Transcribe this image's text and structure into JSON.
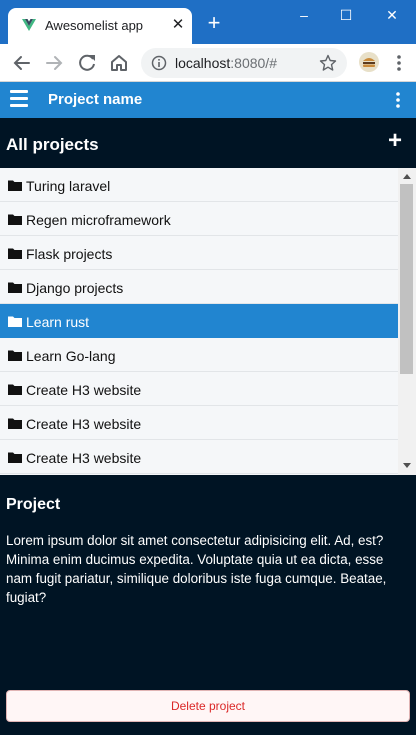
{
  "browser": {
    "tab_title": "Awesomelist app",
    "tab_close": "✕",
    "new_tab": "+",
    "url_host": "localhost",
    "url_rest": ":8080/#",
    "window_controls": [
      "–",
      "☐",
      "✕"
    ],
    "theme_color": "#1f6fc5"
  },
  "appbar": {
    "title": "Project name",
    "color": "#2185d0"
  },
  "projects": {
    "title": "All projects",
    "add_label": "+",
    "items": [
      {
        "label": "Turing laravel",
        "active": false
      },
      {
        "label": "Regen microframework",
        "active": false
      },
      {
        "label": "Flask projects",
        "active": false
      },
      {
        "label": "Django projects",
        "active": false
      },
      {
        "label": "Learn rust",
        "active": true
      },
      {
        "label": "Learn Go-lang",
        "active": false
      },
      {
        "label": "Create H3 website",
        "active": false
      },
      {
        "label": "Create H3 website",
        "active": false
      },
      {
        "label": "Create H3 website",
        "active": false
      }
    ]
  },
  "detail": {
    "title": "Project",
    "body": "Lorem ipsum dolor sit amet consectetur adipisicing elit. Ad, est? Minima enim ducimus expedita. Voluptate quia ut ea dicta, esse nam fugit pariatur, similique doloribus iste fuga cumque. Beatae, fugiat?",
    "delete_label": "Delete project"
  },
  "icons": {
    "folder": "folder-icon",
    "menu": "hamburger-menu-icon",
    "more": "more-vertical-icon"
  },
  "colors": {
    "background": "#001424",
    "list_background": "#f5f7f9",
    "danger": "#db2828"
  }
}
